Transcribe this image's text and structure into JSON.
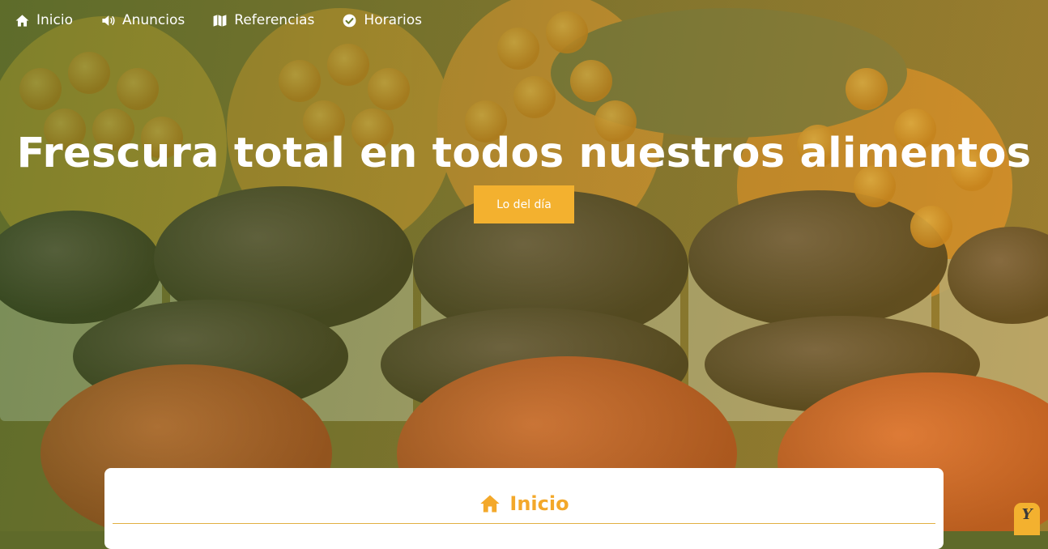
{
  "nav": {
    "items": [
      {
        "label": "Inicio",
        "icon": "home-icon"
      },
      {
        "label": "Anuncios",
        "icon": "megaphone-icon"
      },
      {
        "label": "Referencias",
        "icon": "map-icon"
      },
      {
        "label": "Horarios",
        "icon": "check-circle-icon"
      }
    ]
  },
  "hero": {
    "title": "Frescura total en todos nuestros alimentos",
    "button_label": "Lo del día",
    "background": "fruit-market-photo"
  },
  "section": {
    "title": "Inicio",
    "icon": "home-icon"
  },
  "badge": {
    "label": "Y",
    "icon": "y-logo-badge"
  },
  "colors": {
    "accent": "#f3b12f",
    "heading_accent": "#f3a82a",
    "overlay_green": "#466e1e",
    "overlay_gold": "#c8961e"
  }
}
